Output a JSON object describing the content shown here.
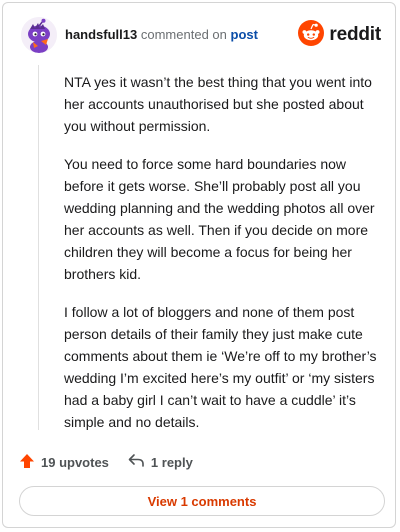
{
  "header": {
    "username": "handsfull13",
    "action_text": "commented on",
    "post_link": "post"
  },
  "brand": {
    "wordmark": "reddit",
    "accent_color": "#ff4500"
  },
  "comment": {
    "paragraphs": [
      "NTA yes it wasn’t the best thing that you went into her accounts unauthorised but she posted about you without permission.",
      "You need to force some hard boundaries now before it gets worse. She’ll probably post all you wedding planning and the wedding photos all over her accounts as well. Then if you decide on more children they will become a focus for being her brothers kid.",
      "I follow a lot of bloggers and none of them post person details of their family they just make cute comments about them ie ‘We’re off to my brother’s wedding I’m excited here’s my outfit’ or ‘my sisters had a baby girl I can’t wait to have a cuddle’ it’s simple and no details."
    ]
  },
  "footer": {
    "upvotes": "19 upvotes",
    "replies": "1 reply",
    "view_button": "View 1 comments"
  },
  "icons": {
    "avatar": "snoo-avatar-icon",
    "logo": "reddit-logo-icon",
    "upvote": "upvote-arrow-icon",
    "reply": "reply-arrow-icon"
  }
}
